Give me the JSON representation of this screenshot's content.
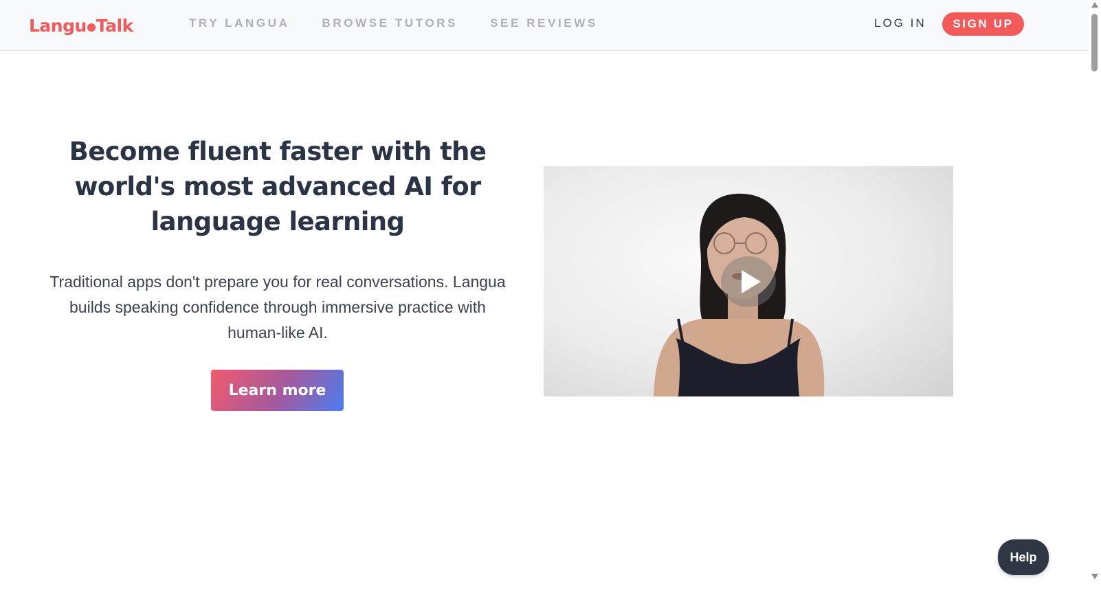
{
  "brand": {
    "logo_left": "Langu",
    "logo_right": "Talk",
    "color": "#f15a5a"
  },
  "nav": {
    "links": [
      {
        "label": "TRY LANGUA"
      },
      {
        "label": "BROWSE TUTORS"
      },
      {
        "label": "SEE REVIEWS"
      }
    ],
    "login_label": "LOG IN",
    "signup_label": "SIGN UP"
  },
  "hero": {
    "title": "Become fluent faster with the world's most advanced AI for language learning",
    "subtitle": "Traditional apps don't prepare you for real conversations. Langua builds speaking confidence through immersive practice with human-like AI.",
    "cta_label": "Learn more"
  },
  "video": {
    "play_icon": "play-icon"
  },
  "help": {
    "label": "Help"
  },
  "colors": {
    "accent": "#f25a5a",
    "dark": "#2f3744",
    "nav_muted": "#aab0bb"
  }
}
